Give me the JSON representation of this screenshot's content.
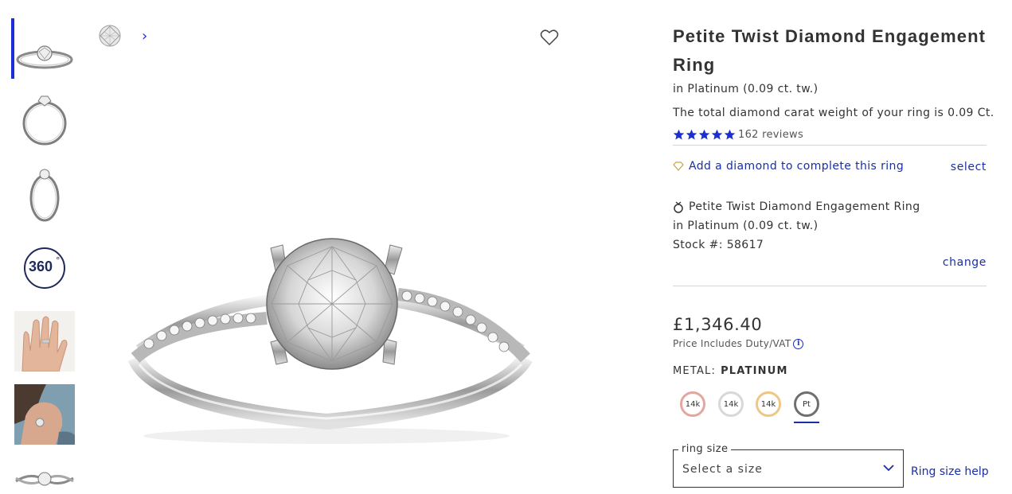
{
  "product": {
    "title": "Petite Twist Diamond Engagement Ring",
    "subtitle": "in Platinum (0.09 ct. tw.)",
    "carat_note": "The total diamond carat weight of your ring is 0.09 Ct.",
    "rating_stars": 5,
    "reviews": "162 reviews"
  },
  "add_diamond": {
    "label": "Add a diamond to complete this ring",
    "select_label": "select"
  },
  "setting": {
    "name": "Petite Twist Diamond Engagement Ring",
    "metal_line": "in Platinum (0.09 ct. tw.)",
    "stock": "Stock #: 58617",
    "change_label": "change"
  },
  "price": {
    "amount": "£1,346.40",
    "duty_note": "Price Includes Duty/VAT",
    "info_glyph": "i"
  },
  "metal": {
    "label": "METAL:",
    "value": "PLATINUM",
    "options": [
      {
        "label": "14k",
        "color": "#e6a6a0"
      },
      {
        "label": "14k",
        "color": "#d8d8d8"
      },
      {
        "label": "14k",
        "color": "#efc785"
      },
      {
        "label": "Pt",
        "color": "#6f6f6f"
      }
    ],
    "selected_index": 3
  },
  "ring_size": {
    "legend": "ring size",
    "placeholder": "Select a size",
    "help_label": "Ring size help"
  },
  "gallery": {
    "thumbnails": [
      "ring-front-view",
      "ring-side-view",
      "ring-angle-view",
      "360-view",
      "ring-on-hand",
      "ring-on-model",
      "ring-top-view"
    ],
    "selected_index": 0,
    "label_360": "360",
    "next_glyph": "›"
  },
  "colors": {
    "accent": "#1a2fd6",
    "link": "#1a2fa6",
    "heart_outline": "#c9a24a"
  }
}
